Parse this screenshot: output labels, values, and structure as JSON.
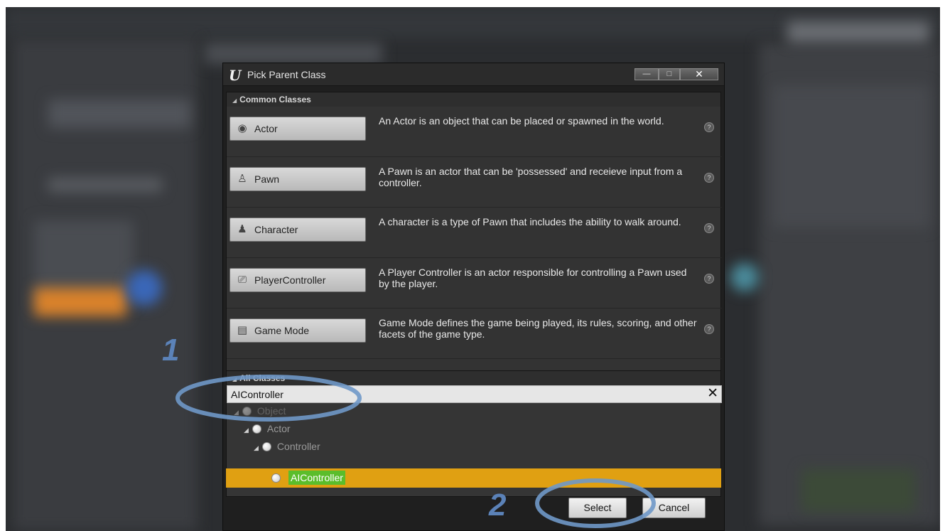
{
  "dialog": {
    "title": "Pick Parent Class",
    "logo_text": "U",
    "window_controls": {
      "minimize": "—",
      "maximize": "□",
      "close": "✕"
    }
  },
  "common_classes": {
    "header": "Common Classes",
    "items": [
      {
        "label": "Actor",
        "icon": "sphere-icon",
        "glyph": "◉",
        "description": "An Actor is an object that can be placed or spawned in the world."
      },
      {
        "label": "Pawn",
        "icon": "pawn-figure-icon",
        "glyph": "♙",
        "description": "A Pawn is an actor that can be 'possessed' and receieve input from a controller."
      },
      {
        "label": "Character",
        "icon": "character-figure-icon",
        "glyph": "♟",
        "description": "A character is a type of Pawn that includes the ability to walk around."
      },
      {
        "label": "PlayerController",
        "icon": "player-controller-icon",
        "glyph": "⎚",
        "description": "A Player Controller is an actor responsible for controlling a Pawn used by the player."
      },
      {
        "label": "Game Mode",
        "icon": "game-mode-icon",
        "glyph": "▤",
        "description": "Game Mode defines the game being played, its rules, scoring, and other facets of the game type."
      }
    ],
    "help_glyph": "?"
  },
  "all_classes": {
    "header": "All Classes",
    "search_value": "AIController",
    "clear_glyph": "✕",
    "tree": [
      {
        "label": "Object",
        "level": 0
      },
      {
        "label": "Actor",
        "level": 1
      },
      {
        "label": "Controller",
        "level": 2
      }
    ],
    "selected": {
      "label": "AIController",
      "level": 3
    }
  },
  "buttons": {
    "select": "Select",
    "cancel": "Cancel"
  },
  "annotations": {
    "step1": "1",
    "step2": "2"
  },
  "colors": {
    "selection": "#e0a012",
    "highlight": "#5bbd2b",
    "annotation": "#5b82b8"
  }
}
